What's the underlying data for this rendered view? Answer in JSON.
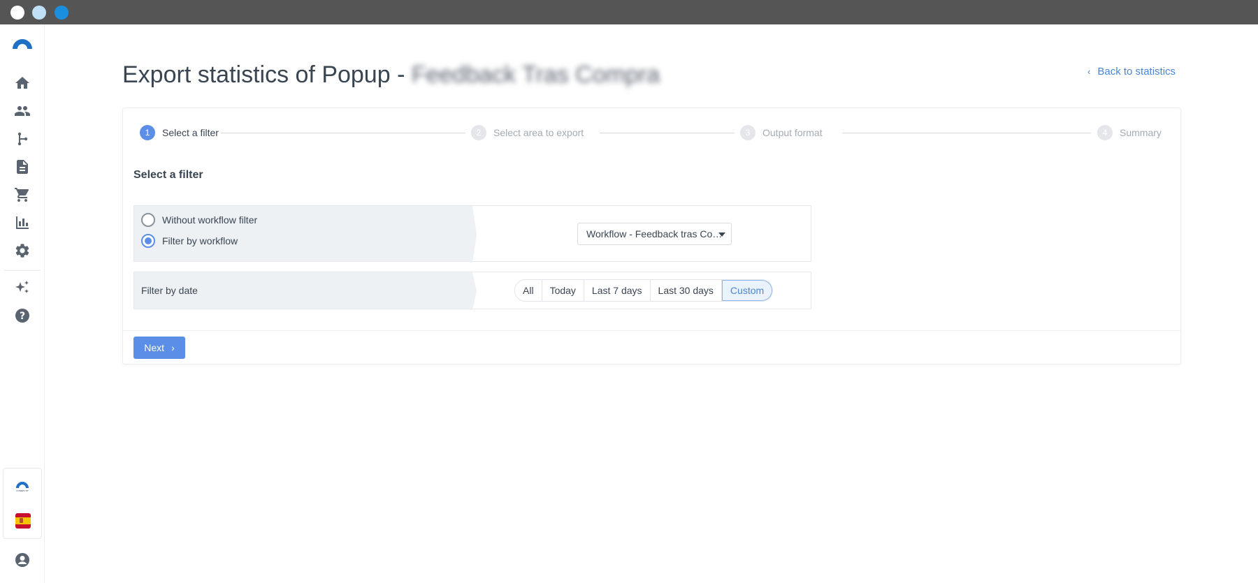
{
  "window": {
    "controls": [
      "close",
      "minimize",
      "maximize"
    ]
  },
  "sidebar": {
    "items": [
      {
        "icon": "home-icon"
      },
      {
        "icon": "contacts-icon"
      },
      {
        "icon": "workflow-icon"
      },
      {
        "icon": "document-icon"
      },
      {
        "icon": "cart-icon"
      },
      {
        "icon": "stats-icon"
      },
      {
        "icon": "gear-icon"
      },
      {
        "icon": "sparkles-icon"
      },
      {
        "icon": "help-icon"
      }
    ],
    "brand_small_text": "CONNECTIF"
  },
  "header": {
    "title": "Export statistics of Popup - ",
    "title_blurred": "Feedback Tras Compra",
    "back_link": "Back to statistics"
  },
  "wizard": {
    "steps": [
      {
        "num": "1",
        "label": "Select a filter",
        "active": true
      },
      {
        "num": "2",
        "label": "Select area to export",
        "active": false
      },
      {
        "num": "3",
        "label": "Output format",
        "active": false
      },
      {
        "num": "4",
        "label": "Summary",
        "active": false
      }
    ]
  },
  "filter": {
    "section_title": "Select a filter",
    "options": [
      {
        "label": "Without workflow filter",
        "checked": false
      },
      {
        "label": "Filter by workflow",
        "checked": true
      }
    ],
    "workflow_select": "Workflow - Feedback tras Co…",
    "date_label": "Filter by date",
    "date_options": [
      "All",
      "Today",
      "Last 7 days",
      "Last 30 days",
      "Custom"
    ],
    "date_selected": "Custom"
  },
  "actions": {
    "next": "Next"
  },
  "colors": {
    "accent": "#5b8ee6",
    "link": "#4a86d4",
    "panel": "#eef1f4"
  }
}
